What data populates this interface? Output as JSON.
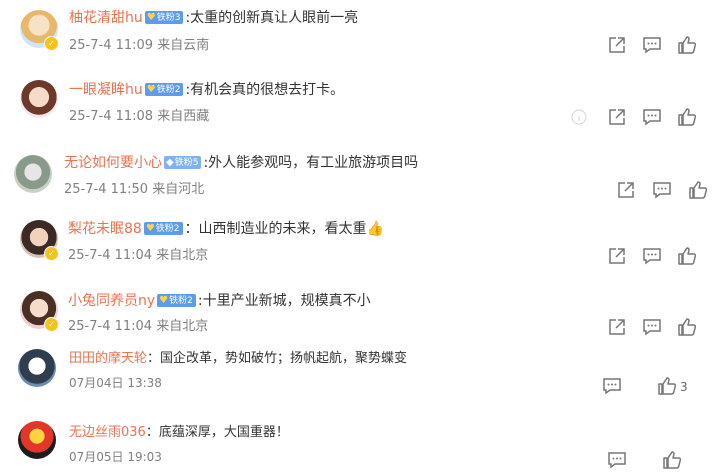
{
  "comments": [
    {
      "name": "柚花清甜hu",
      "badge": "铁粉3",
      "text": ":太重的创新真让人眼前一亮",
      "time": "25-7-4 11:09",
      "loc": "来自云南"
    },
    {
      "name": "一眼凝眸hu",
      "badge": "铁粉2",
      "text": ":有机会真的很想去打卡。",
      "time": "25-7-4 11:08",
      "loc": "来自西藏"
    },
    {
      "name": "无论如何要小心",
      "badge": "铁粉5",
      "text": ":外人能参观吗，有工业旅游项目吗",
      "time": "25-7-4 11:50",
      "loc": "来自河北"
    },
    {
      "name": "梨花未眠88",
      "badge": "铁粉2",
      "text": "：山西制造业的未来，看太重",
      "time": "25-7-4 11:04",
      "loc": "来自北京"
    },
    {
      "name": "小兔同养员ny",
      "badge": "铁粉2",
      "text": ":十里产业新城，规模真不小",
      "time": "25-7-4 11:04",
      "loc": "来自北京"
    },
    {
      "name": "田田的摩天轮",
      "text": "：国企改革，势如破竹；扬帆起航，聚势蝶变",
      "date": "07月04日 13:38",
      "likes": "3"
    },
    {
      "name": "无边丝雨036",
      "text": "：底蕴深厚，大国重器！",
      "date": "07月05日 19:03"
    }
  ],
  "colors": {
    "username": "#eb7350",
    "meta": "#808080",
    "fan_badge": "#5d9cec"
  },
  "icons": [
    "share-icon",
    "comment-icon",
    "like-icon",
    "verified-badge-icon",
    "thumbs-up-emoji"
  ]
}
